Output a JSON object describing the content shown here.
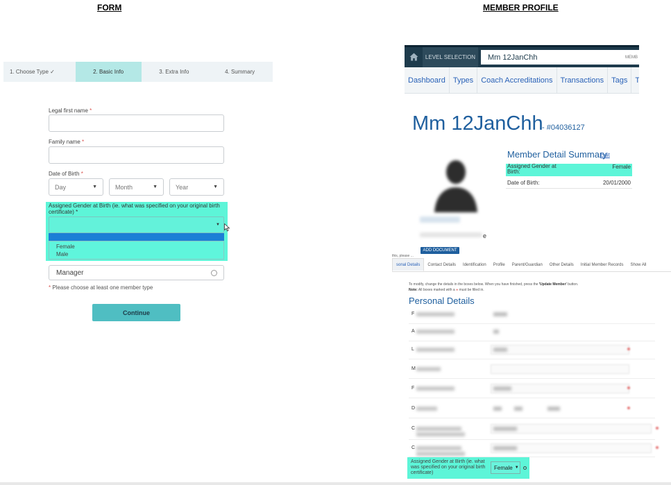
{
  "headings": {
    "form": "FORM",
    "profile": "MEMBER PROFILE"
  },
  "form": {
    "steps": [
      "1. Choose Type ✓",
      "2. Basic Info",
      "3. Extra Info",
      "4. Summary"
    ],
    "active_step": 1,
    "legal_first_name_label": "Legal first name",
    "family_name_label": "Family name",
    "dob_label": "Date of Birth",
    "required_mark": "*",
    "dob_day": "Day",
    "dob_month": "Month",
    "dob_year": "Year",
    "gender_label": "Assigned Gender at Birth (ie. what was specified on your original birth certificate)",
    "gender_options": [
      "Female",
      "Male"
    ],
    "manager_label": "Manager",
    "member_type_note": "Please choose at least one member type",
    "continue_label": "Continue",
    "highlight_color": "#5df5d8"
  },
  "profile": {
    "level_selection": "LEVEL SELECTION",
    "search_value": "Mm 12JanChh",
    "memb_trunc": "MEMB",
    "nav_tabs": [
      "Dashboard",
      "Types",
      "Coach Accreditations",
      "Transactions",
      "Tags",
      "Tribunal"
    ],
    "member_name": "Mm 12JanChh",
    "member_number": "- #04036127",
    "summary_title": "Member Detail Summary",
    "edit_label": "Edit",
    "summary_rows": [
      {
        "key": "Assigned Gender at Birth:",
        "value": "Female"
      },
      {
        "key": "Date of Birth:",
        "value": "20/01/2000"
      }
    ],
    "trail_e": "e",
    "add_document": "ADD DOCUMENT",
    "sub_tabs": [
      "sonal Details",
      "Contact Details",
      "Identification",
      "Profile",
      "Parent/Guardian",
      "Other Details",
      "Initial Member Records",
      "Show All"
    ],
    "thin_text": "this, please ... ",
    "instruction_1": "To modify, change the details in the boxes below. When you have finished, press the ",
    "instruction_update": "'Update Member'",
    "instruction_end": " button.",
    "instruction_note_bold": "Note:",
    "instruction_note": " All boxes marked with a ",
    "instruction_note_end": " must be filled in.",
    "personal_details_title": "Personal Details",
    "row_initials": [
      "F",
      "A",
      "L",
      "M",
      "F",
      "D",
      "C",
      "C"
    ],
    "gender_field_label": "Assigned Gender at Birth (ie. what was specified on your original birth certificate)",
    "gender_field_value": "Female"
  }
}
